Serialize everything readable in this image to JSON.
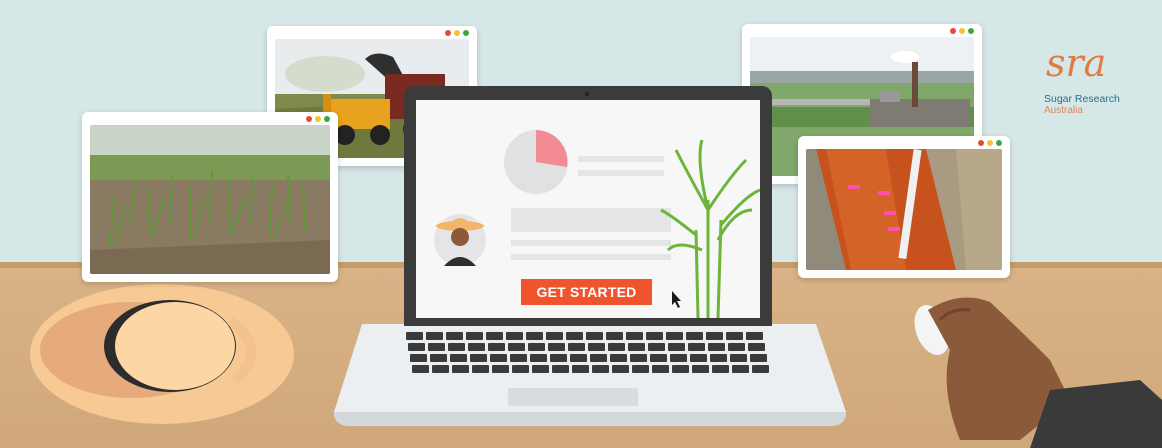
{
  "cta": {
    "label": "GET STARTED"
  },
  "logo": {
    "mark": "sra",
    "name_line1": "Sugar Research",
    "name_line2": "Australia"
  },
  "colors": {
    "wall": "#d6e7e7",
    "desk": "#d9b387",
    "accent": "#f0542d",
    "brand_teal": "#2b6f8a",
    "brand_orange": "#e07b45"
  },
  "photos": [
    {
      "subject": "sugarcane harvester loading haul truck"
    },
    {
      "subject": "young sugarcane shoots in soil"
    },
    {
      "subject": "aerial view of sugar mill with chimney"
    },
    {
      "subject": "soil profile pit with measuring rod"
    }
  ],
  "icons": [
    "cursor-arrow-icon",
    "farmer-avatar-icon",
    "pie-chart-icon",
    "window-dots-icon",
    "computer-mouse-icon"
  ]
}
